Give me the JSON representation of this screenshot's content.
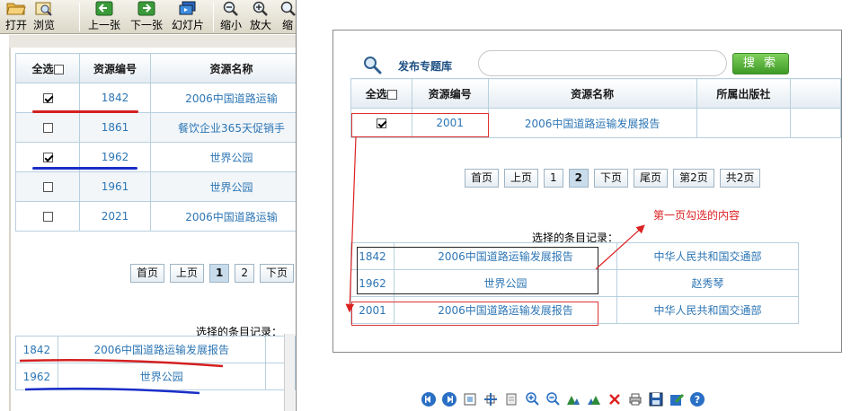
{
  "toolbar": {
    "buttons": [
      {
        "label": "打开",
        "icon": "folder-open-icon"
      },
      {
        "label": "浏览",
        "icon": "browse-icon"
      },
      {
        "label": "上一张",
        "icon": "arrow-left-icon"
      },
      {
        "label": "下一张",
        "icon": "arrow-right-icon"
      },
      {
        "label": "幻灯片",
        "icon": "slideshow-icon"
      },
      {
        "label": "缩小",
        "icon": "zoom-out-icon"
      },
      {
        "label": "放大",
        "icon": "zoom-in-icon"
      },
      {
        "label": "缩",
        "icon": "zoom-icon"
      }
    ]
  },
  "left": {
    "headers": {
      "select_all": "全选",
      "code": "资源编号",
      "name": "资源名称"
    },
    "rows": [
      {
        "checked": true,
        "code": "1842",
        "name": "2006中国道路运输"
      },
      {
        "checked": false,
        "code": "1861",
        "name": "餐饮企业365天促销手"
      },
      {
        "checked": true,
        "code": "1962",
        "name": "世界公园"
      },
      {
        "checked": false,
        "code": "1961",
        "name": "世界公园"
      },
      {
        "checked": false,
        "code": "2021",
        "name": "2006中国道路运输"
      }
    ],
    "pager": {
      "first": "首页",
      "prev": "上页",
      "page1": "1",
      "page2": "2",
      "next": "下页"
    },
    "selected_label": "选择的条目记录：",
    "selected": [
      {
        "code": "1842",
        "name": "2006中国道路运输发展报告"
      },
      {
        "code": "1962",
        "name": "世界公园"
      }
    ]
  },
  "right": {
    "publish_label": "发布专题库",
    "search": {
      "value": "",
      "button": "搜 索"
    },
    "headers": {
      "select_all": "全选",
      "code": "资源编号",
      "name": "资源名称",
      "publisher": "所属出版社"
    },
    "rows": [
      {
        "checked": true,
        "code": "2001",
        "name": "2006中国道路运输发展报告",
        "publisher": ""
      }
    ],
    "pager": {
      "first": "首页",
      "prev": "上页",
      "page1": "1",
      "page2": "2",
      "next": "下页",
      "last": "尾页",
      "current": "第2页",
      "total": "共2页"
    },
    "selected_label": "选择的条目记录：",
    "selected": [
      {
        "code": "1842",
        "name": "2006中国道路运输发展报告",
        "publisher": "中华人民共和国交通部"
      },
      {
        "code": "1962",
        "name": "世界公园",
        "publisher": "赵秀琴"
      },
      {
        "code": "2001",
        "name": "2006中国道路运输发展报告",
        "publisher": "中华人民共和国交通部"
      }
    ],
    "annotation": "第一页勾选的内容"
  },
  "viewer_bottom_icons": [
    "prev-icon",
    "next-icon",
    "fit-icon",
    "actual-size-icon",
    "rotate-icon",
    "zoom-in-icon",
    "zoom-out-icon",
    "rotate-left-icon",
    "rotate-right-icon",
    "delete-icon",
    "print-icon",
    "save-icon",
    "edit-icon",
    "help-icon"
  ],
  "colors": {
    "accent_blue": "#2d76b5",
    "underline_red": "#d42020",
    "underline_blue": "#1a2ec8",
    "search_green": "#4aa82e",
    "annotation_red": "#d22222"
  }
}
